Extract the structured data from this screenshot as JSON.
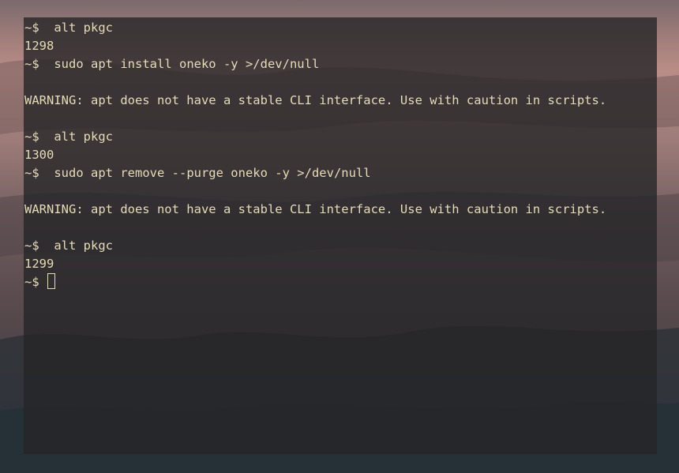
{
  "terminal": {
    "lines": [
      {
        "prompt": "~$",
        "command": "alt pkgc"
      },
      {
        "output": "1298"
      },
      {
        "prompt": "~$",
        "command": "sudo apt install oneko -y >/dev/null"
      },
      {
        "output": ""
      },
      {
        "output": "WARNING: apt does not have a stable CLI interface. Use with caution in scripts."
      },
      {
        "output": ""
      },
      {
        "prompt": "~$",
        "command": "alt pkgc"
      },
      {
        "output": "1300"
      },
      {
        "prompt": "~$",
        "command": "sudo apt remove --purge oneko -y >/dev/null"
      },
      {
        "output": ""
      },
      {
        "output": "WARNING: apt does not have a stable CLI interface. Use with caution in scripts."
      },
      {
        "output": ""
      },
      {
        "prompt": "~$",
        "command": "alt pkgc"
      },
      {
        "output": "1299"
      },
      {
        "prompt": "~$",
        "command": ""
      }
    ]
  },
  "colors": {
    "terminal_text": "#e6dcb8",
    "terminal_bg": "#262628"
  },
  "icons": {
    "cursor": "block-cursor-icon"
  }
}
